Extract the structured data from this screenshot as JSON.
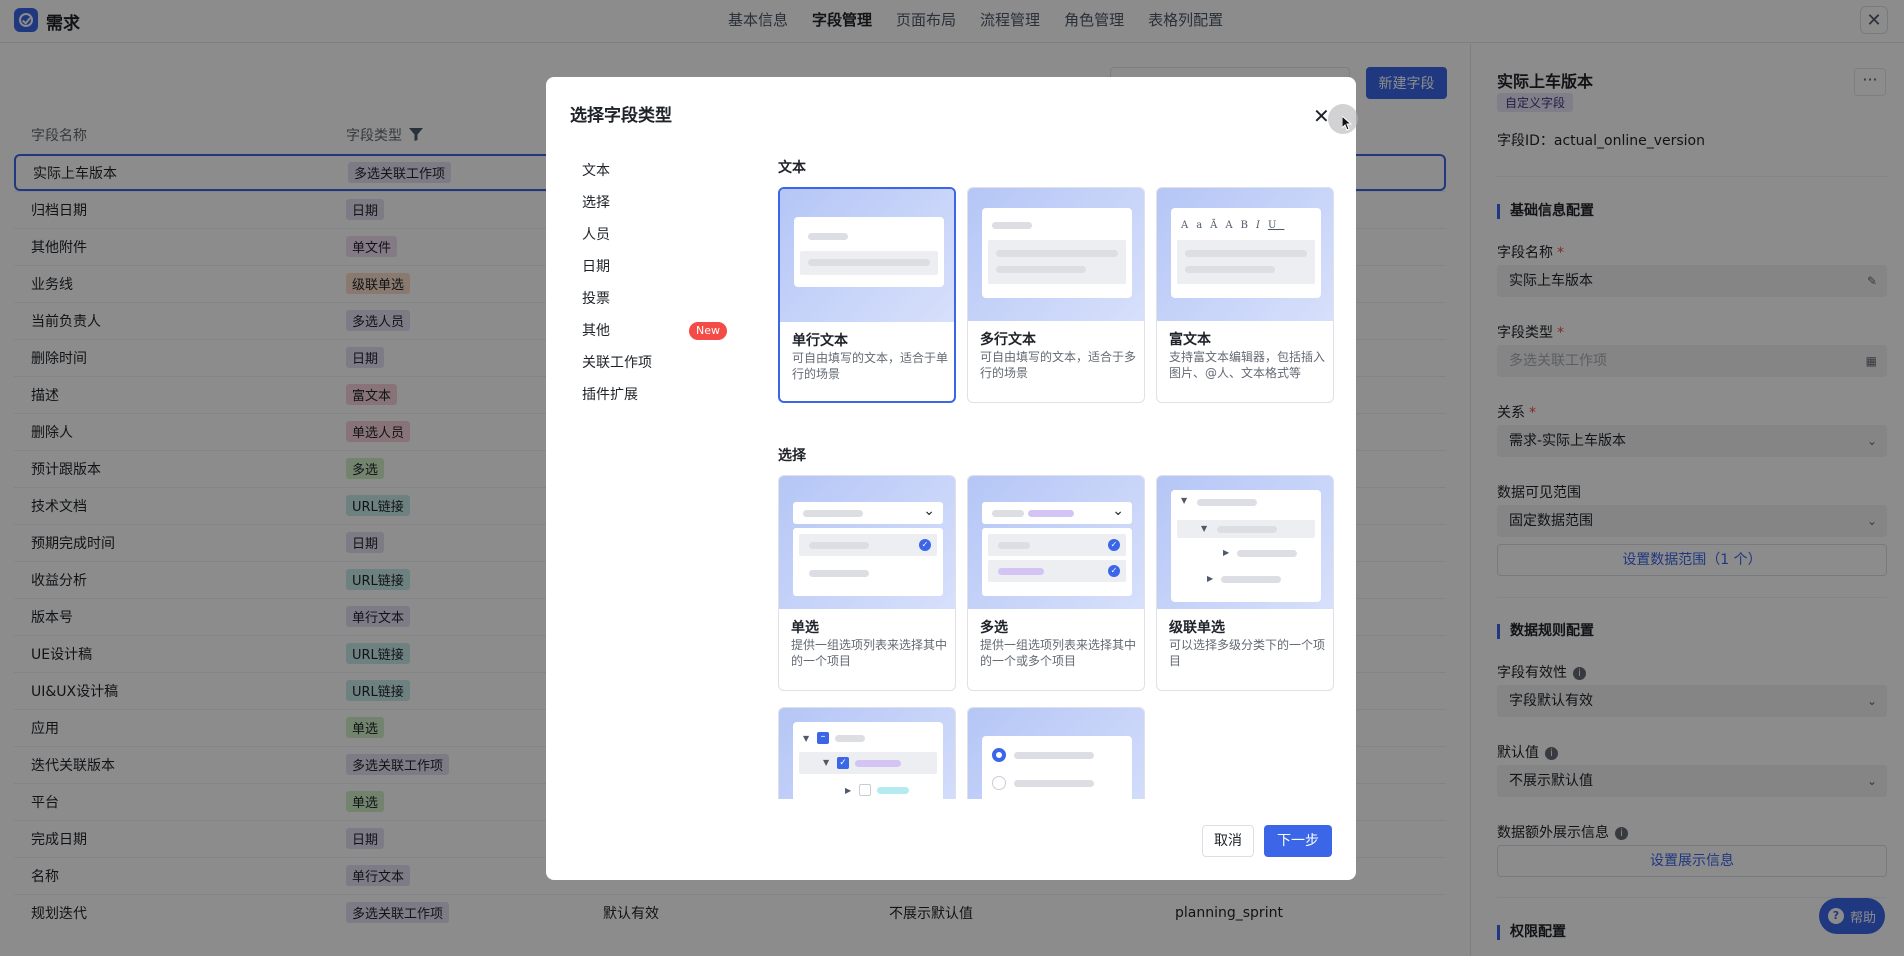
{
  "app": {
    "title": "需求"
  },
  "top_tabs": [
    {
      "label": "基本信息"
    },
    {
      "label": "字段管理"
    },
    {
      "label": "页面布局"
    },
    {
      "label": "流程管理"
    },
    {
      "label": "角色管理"
    },
    {
      "label": "表格列配置"
    }
  ],
  "toolbar": {
    "new_field_label": "新建字段"
  },
  "table": {
    "headers": {
      "name": "字段名称",
      "type": "字段类型"
    },
    "rows": [
      {
        "name": "实际上车版本",
        "type": "多选关联工作项",
        "color": "#e3e1f3"
      },
      {
        "name": "归档日期",
        "type": "日期",
        "color": "#e3e1f3"
      },
      {
        "name": "其他附件",
        "type": "单文件",
        "color": "#f1dff5"
      },
      {
        "name": "业务线",
        "type": "级联单选",
        "color": "#fbdcc9"
      },
      {
        "name": "当前负责人",
        "type": "多选人员",
        "color": "#e3e1f3"
      },
      {
        "name": "删除时间",
        "type": "日期",
        "color": "#e3e1f3"
      },
      {
        "name": "描述",
        "type": "富文本",
        "color": "#f7d2db"
      },
      {
        "name": "删除人",
        "type": "单选人员",
        "color": "#f7d2db"
      },
      {
        "name": "预计跟版本",
        "type": "多选",
        "color": "#cfefc8"
      },
      {
        "name": "技术文档",
        "type": "URL链接",
        "color": "#c6ece9"
      },
      {
        "name": "预期完成时间",
        "type": "日期",
        "color": "#e3e1f3"
      },
      {
        "name": "收益分析",
        "type": "URL链接",
        "color": "#c6ece9"
      },
      {
        "name": "版本号",
        "type": "单行文本",
        "color": "#e3e1f3"
      },
      {
        "name": "UE设计稿",
        "type": "URL链接",
        "color": "#c6ece9"
      },
      {
        "name": "UI&UX设计稿",
        "type": "URL链接",
        "color": "#c6ece9"
      },
      {
        "name": "应用",
        "type": "单选",
        "color": "#cfefc8"
      },
      {
        "name": "迭代关联版本",
        "type": "多选关联工作项",
        "color": "#e3e1f3"
      },
      {
        "name": "平台",
        "type": "单选",
        "color": "#cfefc8"
      },
      {
        "name": "完成日期",
        "type": "日期",
        "color": "#e3e1f3"
      },
      {
        "name": "名称",
        "type": "单行文本",
        "color": "#e3e1f3"
      },
      {
        "name": "规划迭代",
        "type": "多选关联工作项",
        "color": "#e3e1f3",
        "validity": "默认有效",
        "default": "不展示默认值",
        "key": "planning_sprint"
      }
    ]
  },
  "right_panel": {
    "title": "实际上车版本",
    "badge": "自定义字段",
    "field_id": "字段ID：actual_online_version",
    "section_basic": "基础信息配置",
    "name_label": "字段名称",
    "name_value": "实际上车版本",
    "type_label": "字段类型",
    "type_value": "多选关联工作项",
    "relation_label": "关系",
    "relation_value": "需求-实际上车版本",
    "scope_label": "数据可见范围",
    "scope_value": "固定数据范围",
    "scope_btn": "设置数据范围（1 个）",
    "section_rules": "数据规则配置",
    "validity_label": "字段有效性",
    "validity_value": "字段默认有效",
    "default_label": "默认值",
    "default_value": "不展示默认值",
    "extra_label": "数据额外展示信息",
    "extra_btn": "设置展示信息",
    "section_perm": "权限配置",
    "help": "帮助"
  },
  "modal": {
    "title": "选择字段类型",
    "nav": [
      {
        "label": "文本"
      },
      {
        "label": "选择"
      },
      {
        "label": "人员"
      },
      {
        "label": "日期"
      },
      {
        "label": "投票"
      },
      {
        "label": "其他",
        "badge": "New"
      },
      {
        "label": "关联工作项"
      },
      {
        "label": "插件扩展"
      }
    ],
    "section_text": "文本",
    "section_select": "选择",
    "cards_text": [
      {
        "name": "单行文本",
        "desc": "可自由填写的文本，适合于单行的场景"
      },
      {
        "name": "多行文本",
        "desc": "可自由填写的文本，适合于多行的场景"
      },
      {
        "name": "富文本",
        "desc": "支持富文本编辑器，包括插入图片、@人、文本格式等"
      }
    ],
    "cards_select": [
      {
        "name": "单选",
        "desc": "提供一组选项列表来选择其中的一个项目"
      },
      {
        "name": "多选",
        "desc": "提供一组选项列表来选择其中的一个或多个项目"
      },
      {
        "name": "级联单选",
        "desc": "可以选择多级分类下的一个项目"
      }
    ],
    "cancel": "取消",
    "next": "下一步"
  }
}
